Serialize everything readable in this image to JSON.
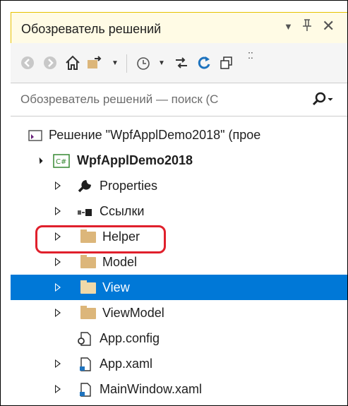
{
  "panel": {
    "title": "Обозреватель решений",
    "title_icons": [
      "chevron-down-icon",
      "pin-icon",
      "close-icon"
    ]
  },
  "toolbar": {
    "items": [
      "back-icon",
      "forward-icon",
      "home-icon",
      "sync-with-active-document-icon",
      "dropdown-icon",
      "pending-changes-icon",
      "dropdown-icon",
      "collapse-icon",
      "refresh-icon",
      "show-all-files-icon",
      "overflow-icon"
    ]
  },
  "search": {
    "placeholder": "Обозреватель решений — поиск (С",
    "search_icon": "search-icon"
  },
  "tree": {
    "solution": "Решение \"WpfApplDemo2018\"  (прое",
    "project": "WpfApplDemo2018",
    "items": [
      {
        "label": "Properties",
        "icon": "wrench-icon"
      },
      {
        "label": "Ссылки",
        "icon": "references-icon"
      },
      {
        "label": "Helper",
        "icon": "folder-icon"
      },
      {
        "label": "Model",
        "icon": "folder-icon"
      },
      {
        "label": "View",
        "icon": "folder-icon",
        "selected": true
      },
      {
        "label": "ViewModel",
        "icon": "folder-icon"
      },
      {
        "label": "App.config",
        "icon": "config-file-icon"
      },
      {
        "label": "App.xaml",
        "icon": "xaml-file-icon"
      },
      {
        "label": "MainWindow.xaml",
        "icon": "xaml-file-icon"
      }
    ]
  },
  "colors": {
    "selection": "#0078d7",
    "annotation": "#e0202c",
    "folder": "#dcb67a"
  }
}
